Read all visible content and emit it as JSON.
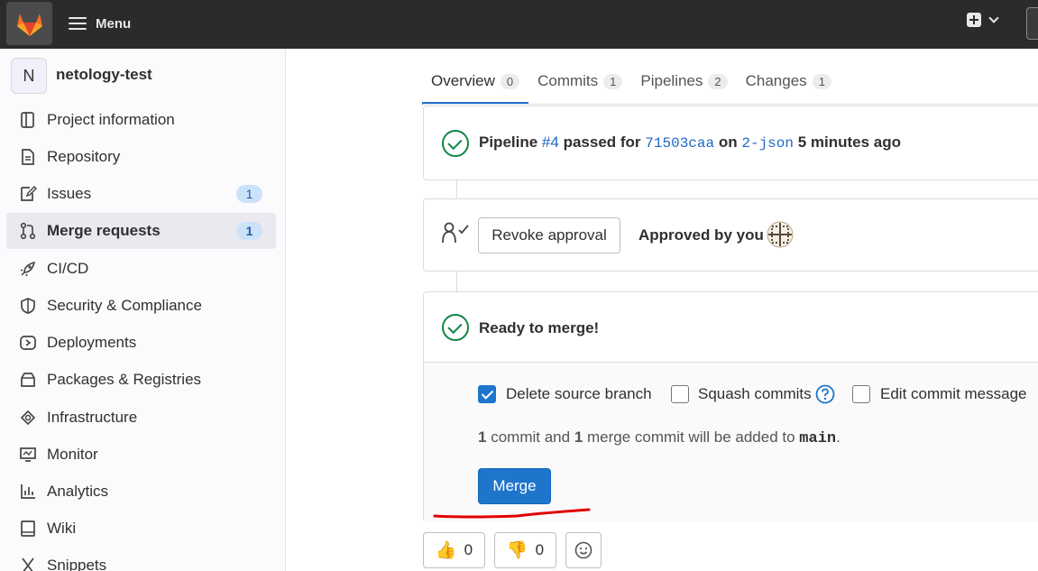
{
  "topbar": {
    "menu_label": "Menu"
  },
  "sidebar": {
    "project_initial": "N",
    "project_name": "netology-test",
    "items": [
      {
        "label": "Project information",
        "icon": "project-info-icon"
      },
      {
        "label": "Repository",
        "icon": "repository-icon"
      },
      {
        "label": "Issues",
        "icon": "issues-icon",
        "badge": "1"
      },
      {
        "label": "Merge requests",
        "icon": "merge-request-icon",
        "badge": "1",
        "active": true
      },
      {
        "label": "CI/CD",
        "icon": "rocket-icon"
      },
      {
        "label": "Security & Compliance",
        "icon": "shield-icon"
      },
      {
        "label": "Deployments",
        "icon": "deployments-icon"
      },
      {
        "label": "Packages & Registries",
        "icon": "package-icon"
      },
      {
        "label": "Infrastructure",
        "icon": "cloud-gear-icon"
      },
      {
        "label": "Monitor",
        "icon": "monitor-icon"
      },
      {
        "label": "Analytics",
        "icon": "chart-icon"
      },
      {
        "label": "Wiki",
        "icon": "book-icon"
      },
      {
        "label": "Snippets",
        "icon": "snippet-icon"
      }
    ]
  },
  "tabs": [
    {
      "label": "Overview",
      "count": "0",
      "active": true
    },
    {
      "label": "Commits",
      "count": "1"
    },
    {
      "label": "Pipelines",
      "count": "2"
    },
    {
      "label": "Changes",
      "count": "1"
    }
  ],
  "pipeline": {
    "prefix": "Pipeline",
    "id": "#4",
    "passed_for": "passed for",
    "commit": "71503caa",
    "on": "on",
    "branch": "2-json",
    "time": "5 minutes ago"
  },
  "approval": {
    "revoke_label": "Revoke approval",
    "approved_text": "Approved by you"
  },
  "merge": {
    "ready_text": "Ready to merge!",
    "delete_source_label": "Delete source branch",
    "delete_source_checked": true,
    "squash_label": "Squash commits",
    "squash_checked": false,
    "edit_message_label": "Edit commit message",
    "edit_message_checked": false,
    "commit_count": "1",
    "commit_text_1": "commit and",
    "merge_commit_count": "1",
    "commit_text_2": "merge commit will be added to",
    "target_branch": "main",
    "period": ".",
    "button_label": "Merge"
  },
  "reactions": {
    "thumbs_up_count": "0",
    "thumbs_down_count": "0"
  },
  "colors": {
    "accent": "#1f75cb",
    "success": "#108548",
    "annotation": "#e00000"
  }
}
